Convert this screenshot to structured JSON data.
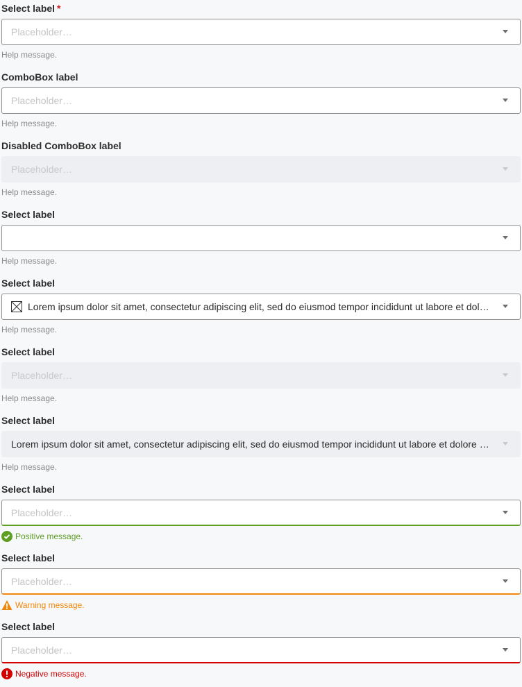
{
  "fields": [
    {
      "label": "Select label",
      "required_mark": "*",
      "placeholder": "Placeholder…",
      "help": "Help message."
    },
    {
      "label": "ComboBox label",
      "placeholder": "Placeholder…",
      "help": "Help message."
    },
    {
      "label": "Disabled ComboBox label",
      "placeholder": "Placeholder…",
      "help": "Help message."
    },
    {
      "label": "Select label",
      "value": "",
      "help": "Help message."
    },
    {
      "label": "Select label",
      "value": "Lorem ipsum dolor sit amet, consectetur adipiscing elit, sed do eiusmod tempor incididunt ut labore et dolore magna aliqua.",
      "icon": "image-placeholder-icon",
      "help": "Help message."
    },
    {
      "label": "Select label",
      "placeholder": "Placeholder…",
      "help": "Help message."
    },
    {
      "label": "Select label",
      "value": "Lorem ipsum dolor sit amet, consectetur adipiscing elit, sed do eiusmod tempor incididunt ut labore et dolore magna aliqua.",
      "help": "Help message."
    },
    {
      "label": "Select label",
      "placeholder": "Placeholder…",
      "help": "Positive message.",
      "status": "positive"
    },
    {
      "label": "Select label",
      "placeholder": "Placeholder…",
      "help": "Warning message.",
      "status": "warning"
    },
    {
      "label": "Select label",
      "placeholder": "Placeholder…",
      "help": "Negative message.",
      "status": "negative"
    }
  ],
  "colors": {
    "positive": "#5e9e22",
    "warning": "#f0870b",
    "negative": "#d40000",
    "required": "#d7191c"
  }
}
